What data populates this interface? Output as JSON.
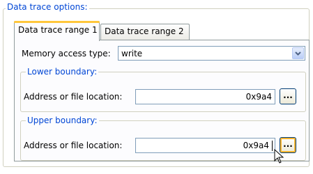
{
  "options_group": {
    "title": "Data trace options:"
  },
  "tabs": [
    {
      "label": "Data trace range 1",
      "active": true
    },
    {
      "label": "Data trace range 2",
      "active": false
    }
  ],
  "memory_access": {
    "label": "Memory access type:",
    "value": "write"
  },
  "lower_boundary": {
    "title": "Lower boundary:",
    "address_label": "Address or file location:",
    "address_value": "0x9a4",
    "browse_label": "..."
  },
  "upper_boundary": {
    "title": "Upper boundary:",
    "address_label": "Address or file location:",
    "address_value": "0x9a4",
    "browse_label": "..."
  },
  "colors": {
    "accent": "#0046d5",
    "tab_highlight": "#ffc73c"
  },
  "icons": {
    "dropdown": "chevron-down-icon",
    "cursor": "mouse-pointer-icon"
  }
}
